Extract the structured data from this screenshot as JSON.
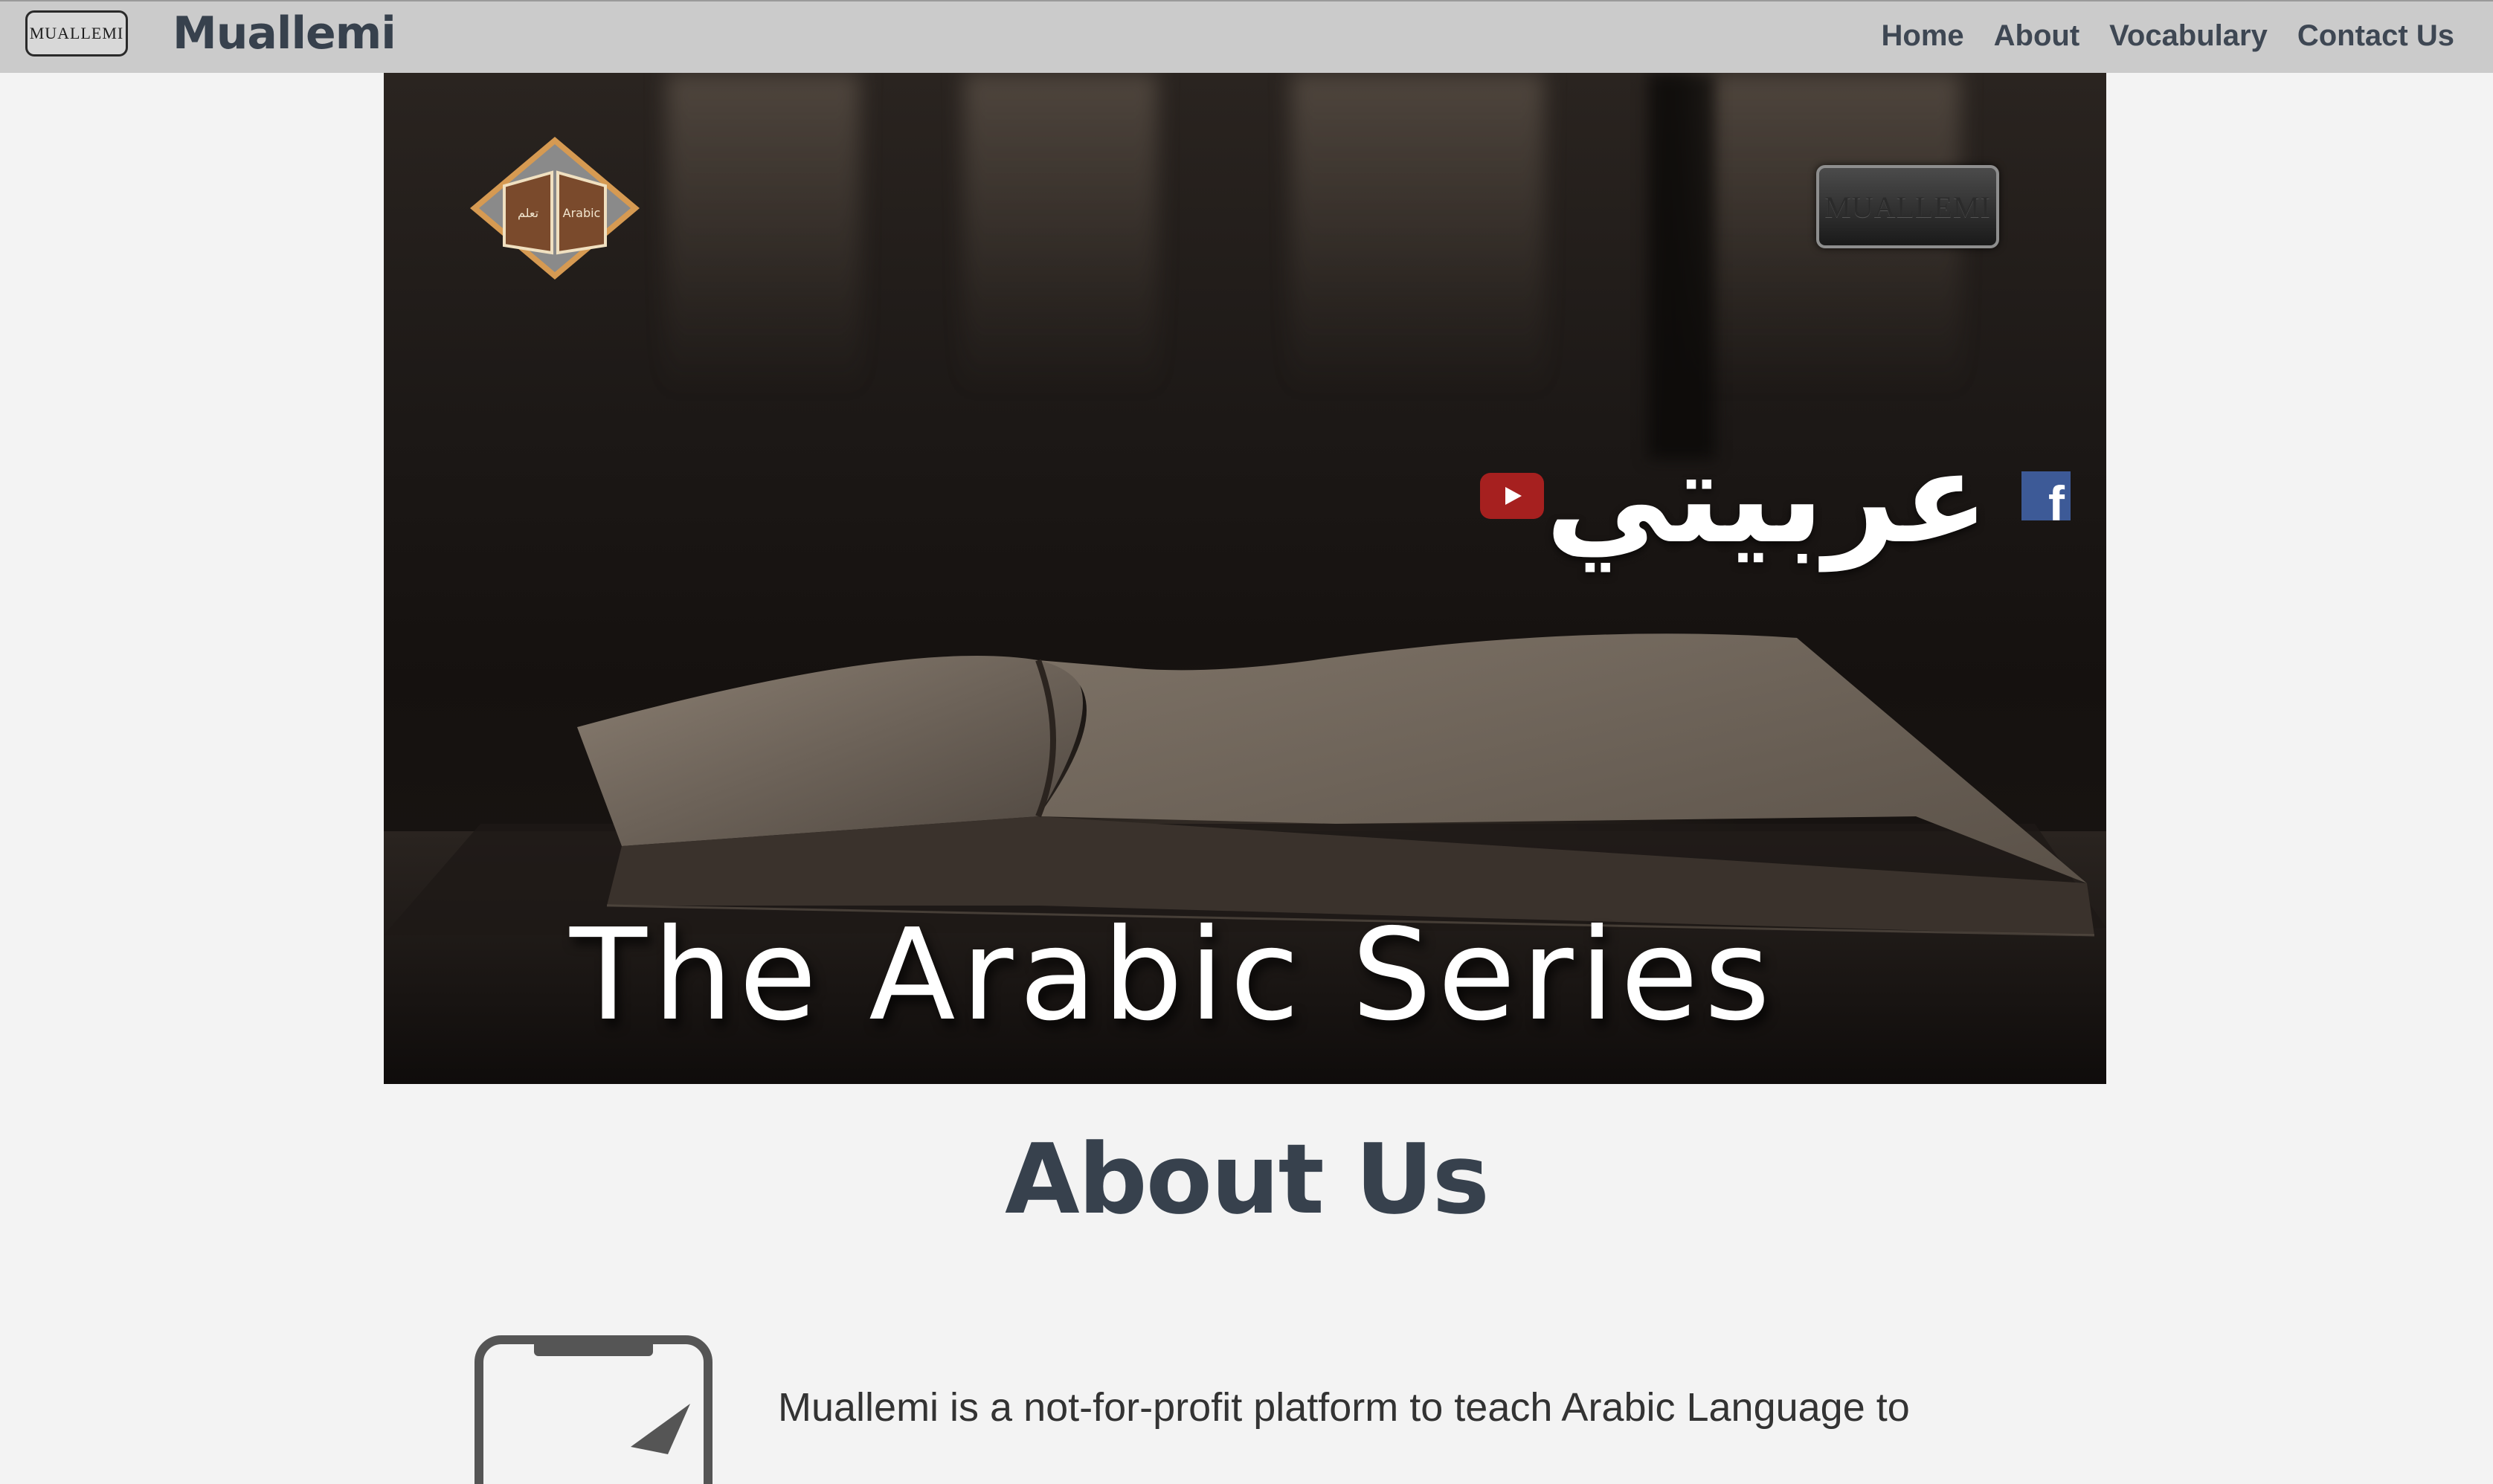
{
  "navbar": {
    "logo_text": "MUALLEMI",
    "brand": "Muallemi",
    "links": [
      "Home",
      "About",
      "Vocabulary",
      "Contact Us"
    ]
  },
  "hero": {
    "plate_text": "MUALLEMI",
    "arabic_title": "عربيتي",
    "title": "The Arabic Series",
    "social_icons": [
      "youtube-icon",
      "facebook-icon"
    ],
    "badge_icon": "book-badge-icon"
  },
  "about": {
    "heading": "About Us",
    "intro_text": "Muallemi is a not-for-profit platform to teach Arabic Language to",
    "icon": "phone-icon"
  },
  "colors": {
    "navbar_bg": "#cbcbcb",
    "heading": "#37414d",
    "youtube": "#a6201f",
    "facebook": "#3d5a97",
    "page_bg": "#f3f3f3"
  }
}
